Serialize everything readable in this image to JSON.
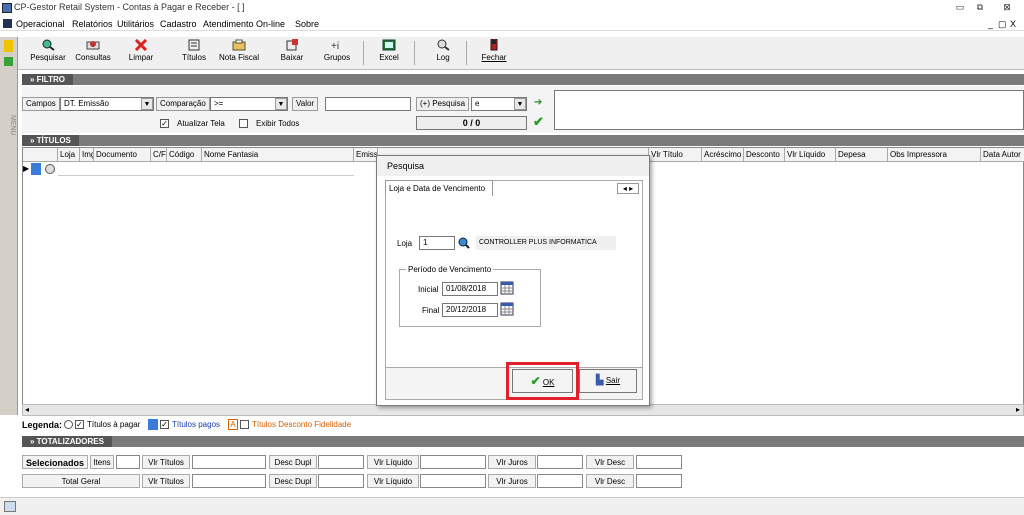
{
  "window": {
    "title": "CP-Gestor Retail System - Contas à Pagar e Receber - [ ]",
    "min": "▭",
    "restore": "⧉",
    "close": "⊠",
    "mdi_min": "_",
    "mdi_restore": "▢",
    "mdi_close": "X"
  },
  "menubar": {
    "items": [
      "Operacional",
      "Relatórios",
      "Utilitários",
      "Cadastro",
      "Atendimento On-line",
      "Sobre"
    ]
  },
  "leftstrip": {
    "label": "MENU"
  },
  "toolbar": {
    "buttons": [
      {
        "label": "Pesquisar",
        "icon": "search-icon"
      },
      {
        "label": "Consultas",
        "icon": "consult-icon"
      },
      {
        "label": "Limpar",
        "icon": "clear-icon"
      },
      {
        "label": "Títulos",
        "icon": "titles-icon"
      },
      {
        "label": "Nota Fiscal",
        "icon": "invoice-icon"
      },
      {
        "label": "Baixar",
        "icon": "download-icon"
      },
      {
        "label": "Grupos",
        "icon": "groups-icon"
      },
      {
        "label": "Excel",
        "icon": "excel-icon"
      },
      {
        "label": "Log",
        "icon": "log-icon"
      },
      {
        "label": "Fechar",
        "icon": "close-door-icon"
      }
    ]
  },
  "filtro": {
    "section": "» FILTRO",
    "campos_label": "Campos",
    "campos_value": "DT. Emissão",
    "comparacao_label": "Comparação",
    "comparacao_value": ">=",
    "valor_label": "Valor",
    "valor_value": "",
    "pesquisa_label": "(+) Pesquisa",
    "pesquisa_value": "e",
    "atualizar_label": "Atualizar Tela",
    "atualizar_checked": "✓",
    "exibir_label": "Exibir Todos",
    "counter": "0 / 0",
    "arrow": "➔",
    "confirm": "✔"
  },
  "titulos": {
    "section": "» TÍTULOS",
    "columns": [
      "Loja",
      "Img",
      "Documento",
      "C/F",
      "Código",
      "Nome Fantasia",
      "Emissão",
      "",
      "Vlr Título",
      "Acréscimo",
      "Desconto",
      "Vlr Líquido",
      "Depesa",
      "Obs Impressora",
      "Data Autor"
    ],
    "row_marker": "▶"
  },
  "legend": {
    "label": "Legenda:",
    "a_pagar": "Títulos à pagar",
    "pagos": "Títulos pagos",
    "desconto_box": "A",
    "desconto": "Títulos Desconto Fidelidade"
  },
  "totalizadores": {
    "section": "» TOTALIZADORES",
    "selecionados": "Selecionados",
    "itens": "Itens",
    "total_geral": "Total Geral",
    "fields": [
      "Vlr Títulos",
      "Desc Dupl",
      "Vlr Líquido",
      "Vlr Juros",
      "Vlr Desc"
    ]
  },
  "dialog": {
    "title": "Pesquisa",
    "tab": "Loja e Data de Vencimento",
    "loja_label": "Loja",
    "loja_value": "1",
    "loja_name": "CONTROLLER PLUS INFORMATICA",
    "periodo_label": "Período de Vencimento",
    "inicial_label": "Inicial",
    "inicial_value": "01/08/2018",
    "final_label": "Final",
    "final_value": "20/12/2018",
    "ok": "OK",
    "sair": "Sair"
  },
  "colors": {
    "highlight": "#e0202a",
    "section": "#5a5a5a",
    "ok_icon": "#2a9a2a"
  }
}
